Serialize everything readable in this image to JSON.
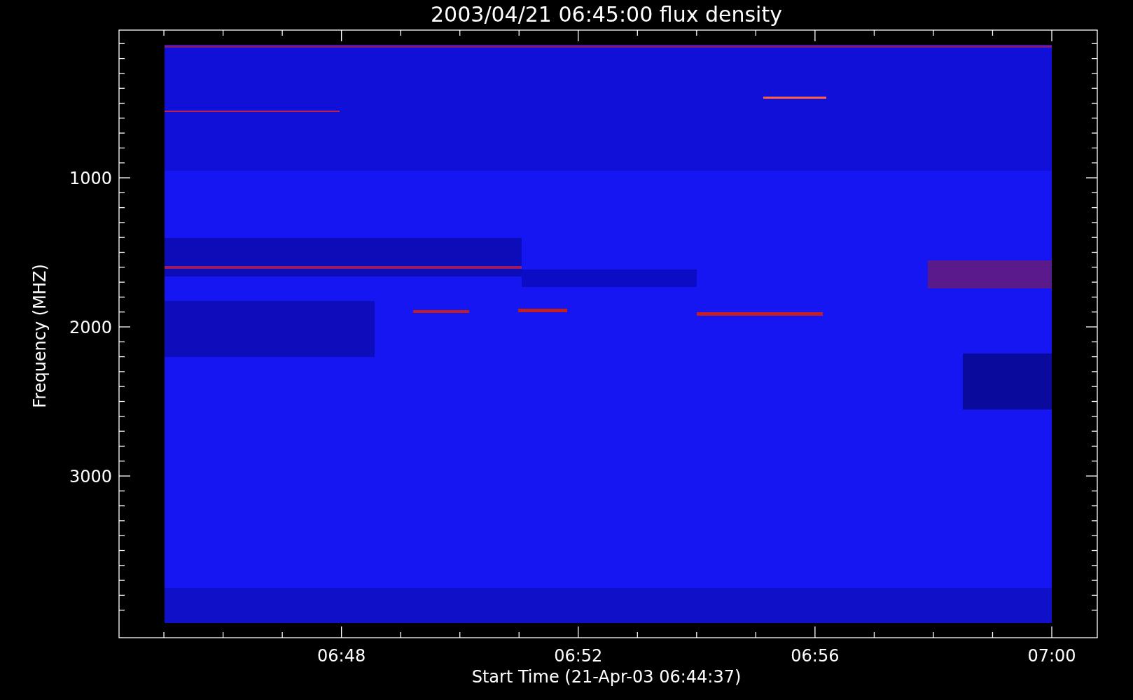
{
  "title": "2003/04/21 06:45:00 flux density",
  "chart": {
    "xlabel": "Start Time (21-Apr-03 06:44:37)",
    "ylabel": "Frequency (MHZ)",
    "xticks": [
      "06:48",
      "06:52",
      "06:56",
      "07:00"
    ],
    "yticks": [
      "1000",
      "2000",
      "3000"
    ]
  }
}
